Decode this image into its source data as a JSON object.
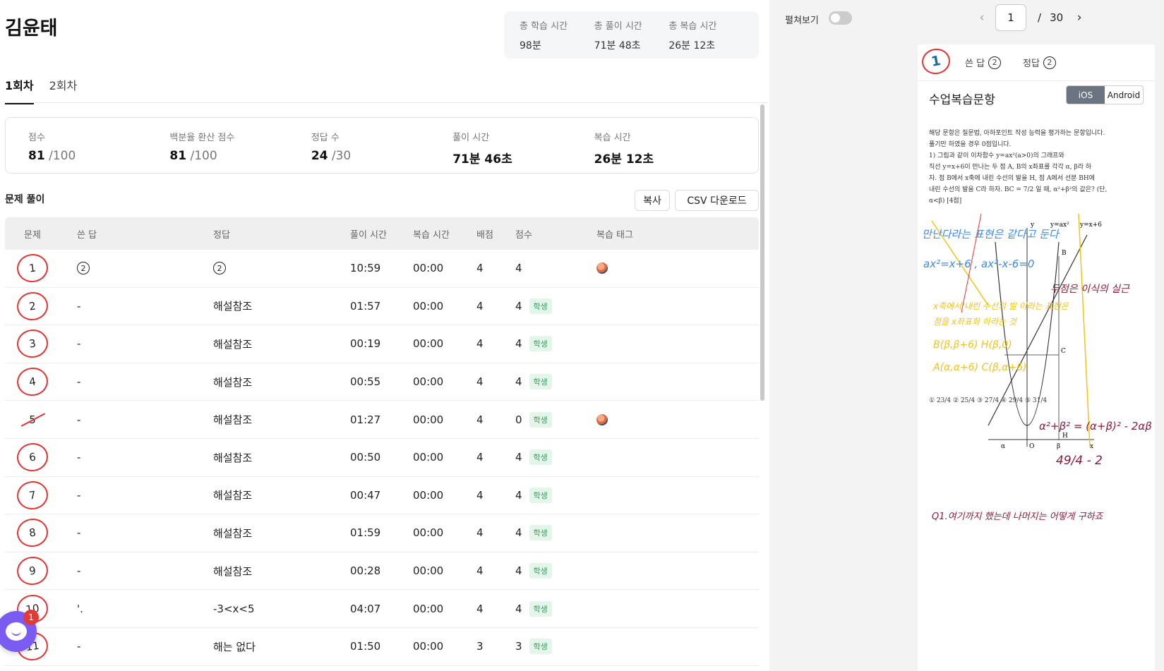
{
  "student": {
    "name": "김윤태"
  },
  "summary": [
    {
      "label": "총 학습 시간",
      "value": "98분"
    },
    {
      "label": "총 풀이 시간",
      "value": "71분 48초"
    },
    {
      "label": "총 복습 시간",
      "value": "26분 12초"
    }
  ],
  "tabs": [
    {
      "label": "1회차",
      "active": true
    },
    {
      "label": "2회차",
      "active": false
    }
  ],
  "score": {
    "score_label": "점수",
    "score_value": "81",
    "score_total": "/100",
    "percent_label": "백분율 환산 점수",
    "percent_value": "81",
    "percent_total": "/100",
    "correct_label": "정답 수",
    "correct_value": "24",
    "correct_total": "/30",
    "solve_label": "풀이 시간",
    "solve_value": "71분 46초",
    "review_label": "복습 시간",
    "review_value": "26분 12초"
  },
  "section": {
    "title": "문제 풀이",
    "copy_label": "복사",
    "csv_label": "CSV 다운로드"
  },
  "table": {
    "headers": {
      "num": "문제",
      "answer": "쓴 답",
      "correct": "정답",
      "time": "풀이 시간",
      "review": "복습 시간",
      "points": "배점",
      "score": "점수",
      "tag": "복습 태그"
    },
    "badge": "학생",
    "rows": [
      {
        "num": "1",
        "answer": "2",
        "correct": "2",
        "time": "10:59",
        "review": "00:00",
        "points": "4",
        "score": "4",
        "mark": "correct",
        "answer_circled": true,
        "badge": false,
        "avatar": true
      },
      {
        "num": "2",
        "answer": "-",
        "correct": "해설참조",
        "time": "01:57",
        "review": "00:00",
        "points": "4",
        "score": "4",
        "mark": "correct",
        "badge": true,
        "avatar": false
      },
      {
        "num": "3",
        "answer": "-",
        "correct": "해설참조",
        "time": "00:19",
        "review": "00:00",
        "points": "4",
        "score": "4",
        "mark": "correct",
        "badge": true,
        "avatar": false
      },
      {
        "num": "4",
        "answer": "-",
        "correct": "해설참조",
        "time": "00:55",
        "review": "00:00",
        "points": "4",
        "score": "4",
        "mark": "correct",
        "badge": true,
        "avatar": false
      },
      {
        "num": "5",
        "answer": "-",
        "correct": "해설참조",
        "time": "01:27",
        "review": "00:00",
        "points": "4",
        "score": "0",
        "mark": "wrong",
        "badge": true,
        "avatar": true
      },
      {
        "num": "6",
        "answer": "-",
        "correct": "해설참조",
        "time": "00:50",
        "review": "00:00",
        "points": "4",
        "score": "4",
        "mark": "correct",
        "badge": true,
        "avatar": false
      },
      {
        "num": "7",
        "answer": "-",
        "correct": "해설참조",
        "time": "00:47",
        "review": "00:00",
        "points": "4",
        "score": "4",
        "mark": "correct",
        "badge": true,
        "avatar": false
      },
      {
        "num": "8",
        "answer": "-",
        "correct": "해설참조",
        "time": "01:59",
        "review": "00:00",
        "points": "4",
        "score": "4",
        "mark": "correct",
        "badge": true,
        "avatar": false
      },
      {
        "num": "9",
        "answer": "-",
        "correct": "해설참조",
        "time": "00:28",
        "review": "00:00",
        "points": "4",
        "score": "4",
        "mark": "correct",
        "badge": true,
        "avatar": false
      },
      {
        "num": "10",
        "answer": "'.",
        "correct": "-3<x<5",
        "time": "04:07",
        "review": "00:00",
        "points": "4",
        "score": "4",
        "mark": "correct",
        "badge": true,
        "avatar": false
      },
      {
        "num": "11",
        "answer": "-",
        "correct": "해는 없다",
        "time": "01:50",
        "review": "00:00",
        "points": "3",
        "score": "3",
        "mark": "correct",
        "badge": true,
        "avatar": false
      }
    ]
  },
  "chat": {
    "badge": "1"
  },
  "viewer": {
    "toggle_label": "펼쳐보기",
    "page_current": "1",
    "page_sep": "/",
    "page_total": "30",
    "prev_icon": "‹",
    "next_icon": "›",
    "q_num": "1",
    "answer_label": "쓴 답",
    "answer_value": "2",
    "correct_label": "정답",
    "correct_value": "2",
    "sheet_title": "수업복습문항",
    "os_ios": "iOS",
    "os_android": "Android",
    "problem_lines": [
      "해당 문항은 질문법, 아하포인트 작성 능력을 평가하는 문항입니다.",
      "풀기만 하였을 경우 0점입니다.",
      "1) 그림과 같이 이차함수 y=ax²(a>0)의 그래프와",
      "직선 y=x+6이 만나는 두 점 A, B의 x좌표를 각각 α, β라 하",
      "자. 점 B에서 x축에 내린 수선의 발을 H, 점 A에서 선분 BH에",
      "내린 수선의 발을 C라 하자. BC = 7/2 일 때, α²+β²의 값은? (단,",
      "α<β) [4점]"
    ],
    "graph_labels": {
      "y_axis": "y",
      "curve": "y=ax²",
      "line": "y=x+6",
      "pt_b": "B",
      "pt_c": "C",
      "pt_h": "H",
      "pt_o": "O",
      "alpha": "α",
      "beta": "β",
      "x_axis": "x"
    },
    "choices": "① 23/4   ② 25/4   ③ 27/4   ④ 29/4   ⑤ 31/4",
    "handwriting": {
      "blue1": "만난다라는 표현은 같다고 둔다",
      "blue2": "ax²=x+6 , ax²-x-6=0",
      "maroon1": "두점은 이식의 실근",
      "yellow1": "x축에서 내린 수선의 발 이라는 표현은",
      "yellow2": "점을 x좌표화 하라는 것",
      "yellow3": "B(β,β+6) H(β,0)",
      "yellow4": "A(α,α+6) C(β,α+6)",
      "maroon2": "α²+β² = (α+β)² - 2αβ",
      "maroon3": "49/4 - 2",
      "maroon4": "Q1.여기까지 했는데 나머지는 어떻게 구하죠"
    }
  },
  "colors": {
    "mark_red": "#e03434",
    "badge_green": "#2f9e5b",
    "chat_purple": "#7a5cf2",
    "ios_active": "#6b7480",
    "hw_blue": "#3b8be0",
    "hw_yellow": "#f0c419",
    "hw_maroon": "#8a1d3a"
  }
}
